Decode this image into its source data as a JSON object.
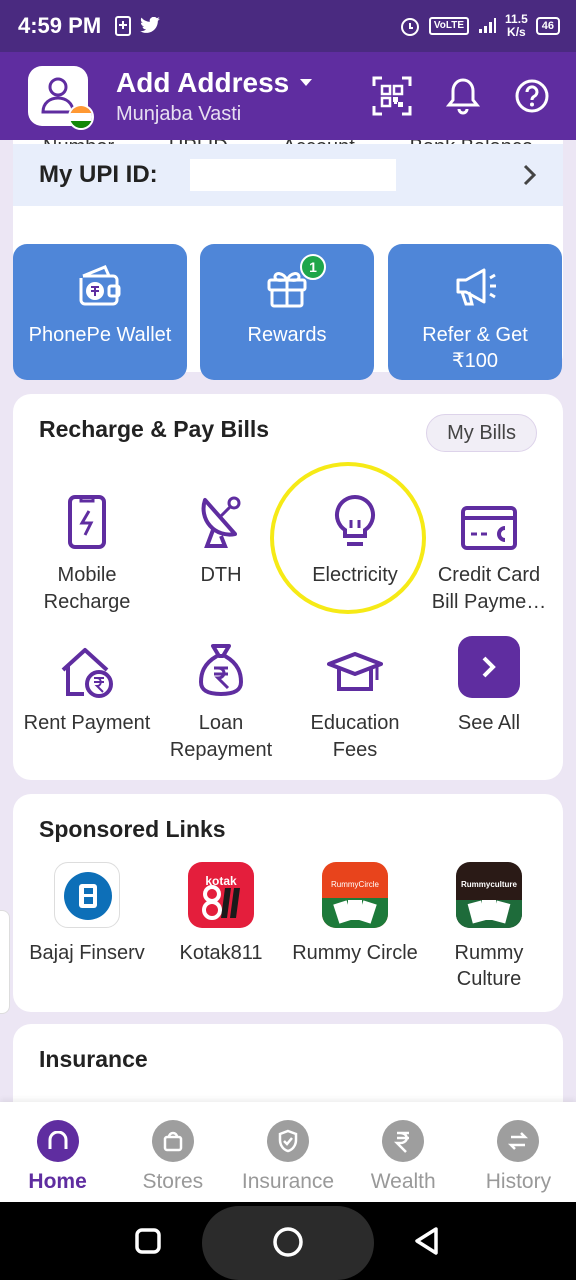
{
  "status_bar": {
    "time": "4:59 PM",
    "network_label": "VoLTE",
    "speed_value": "11.5",
    "speed_unit": "K/s",
    "battery": "46"
  },
  "header": {
    "title": "Add Address",
    "subtitle": "Munjaba Vasti"
  },
  "upi": {
    "cut_labels": [
      "Number",
      "UPI ID",
      "Account",
      "Bank Balance"
    ],
    "label": "My UPI ID:"
  },
  "quick_actions": [
    {
      "label": "PhonePe Wallet",
      "icon": "wallet-icon"
    },
    {
      "label": "Rewards",
      "icon": "gift-icon",
      "badge": "1"
    },
    {
      "label": "Refer & Get ₹100",
      "icon": "megaphone-icon"
    }
  ],
  "bills": {
    "title": "Recharge & Pay Bills",
    "my_bills": "My Bills",
    "services": [
      {
        "label": "Mobile Recharge",
        "icon": "mobile-icon"
      },
      {
        "label": "DTH",
        "icon": "satellite-dish-icon"
      },
      {
        "label": "Electricity",
        "icon": "bulb-icon"
      },
      {
        "label": "Credit Card Bill Payme…",
        "icon": "credit-card-icon"
      },
      {
        "label": "Rent Payment",
        "icon": "house-rupee-icon"
      },
      {
        "label": "Loan Repayment",
        "icon": "money-bag-icon"
      },
      {
        "label": "Education Fees",
        "icon": "graduation-cap-icon"
      },
      {
        "label": "See All",
        "icon": "chevron-right-icon"
      }
    ]
  },
  "sponsored": {
    "title": "Sponsored Links",
    "items": [
      {
        "label": "Bajaj Finserv",
        "icon": "bajaj-finserv-logo"
      },
      {
        "label": "Kotak811",
        "icon": "kotak811-logo",
        "logo_text": "kotak"
      },
      {
        "label": "Rummy Circle",
        "icon": "rummy-circle-logo",
        "logo_text": "RummyCircle"
      },
      {
        "label": "Rummy Culture",
        "icon": "rummy-culture-logo",
        "logo_text": "Rummyculture"
      }
    ]
  },
  "insurance": {
    "title": "Insurance"
  },
  "bottom_nav": [
    {
      "label": "Home",
      "active": true
    },
    {
      "label": "Stores"
    },
    {
      "label": "Insurance"
    },
    {
      "label": "Wealth"
    },
    {
      "label": "History"
    }
  ],
  "colors": {
    "brand_purple": "#5f2da0",
    "tile_blue": "#4f86d8",
    "highlight_ring": "#f6ea16"
  }
}
